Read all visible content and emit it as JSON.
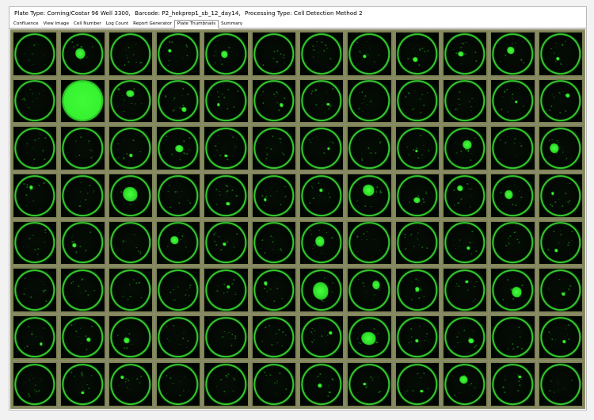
{
  "header": {
    "plate_type": "Plate Type:  Corning/Costar 96 Well 3300,",
    "barcode": "Barcode:  P2_hekprep1_sb_12_day14,",
    "processing_type": "Processing Type:  Cell Detection Method 2"
  },
  "tabs": [
    {
      "label": "Confluence",
      "active": false
    },
    {
      "label": "View Image",
      "active": false
    },
    {
      "label": "Cell Number",
      "active": false
    },
    {
      "label": "Log Count",
      "active": false
    },
    {
      "label": "Report Generator",
      "active": false
    },
    {
      "label": "Plate Thumbnails",
      "active": true
    },
    {
      "label": "Summary",
      "active": false
    }
  ],
  "plate": {
    "rows": 8,
    "cols": 12,
    "colors": {
      "well_ring": "#33c82d",
      "colony": "#39f232",
      "background": "#020602",
      "cell_border": "#7f8455"
    },
    "wells": [
      [
        0,
        0.35,
        0,
        0.05,
        0.25,
        0,
        0,
        0.12,
        0.2,
        0.2,
        0.25,
        0.05
      ],
      [
        0,
        1.0,
        0.3,
        0.2,
        0.12,
        0.15,
        0.08,
        0,
        0,
        0,
        0.05,
        0.15
      ],
      [
        0,
        0,
        0.05,
        0.3,
        0.05,
        0,
        0.05,
        0,
        0.08,
        0.35,
        0,
        0.35
      ],
      [
        0.15,
        0,
        0.55,
        0,
        0.15,
        0.1,
        0.08,
        0.45,
        0.25,
        0.2,
        0.3,
        0.1
      ],
      [
        0,
        0.15,
        0,
        0.3,
        0.12,
        0,
        0.35,
        0,
        0,
        0.08,
        0,
        0.12
      ],
      [
        0,
        0,
        0,
        0,
        0.05,
        0.05,
        0.6,
        0.3,
        0.15,
        0.05,
        0.35,
        0.05
      ],
      [
        0.05,
        0.15,
        0.2,
        0,
        0,
        0,
        0.05,
        0.55,
        0.05,
        0.2,
        0,
        0.05
      ],
      [
        0,
        0.05,
        0.1,
        0,
        0,
        0,
        0.15,
        0.12,
        0.05,
        0.3,
        0.05,
        0
      ]
    ]
  }
}
